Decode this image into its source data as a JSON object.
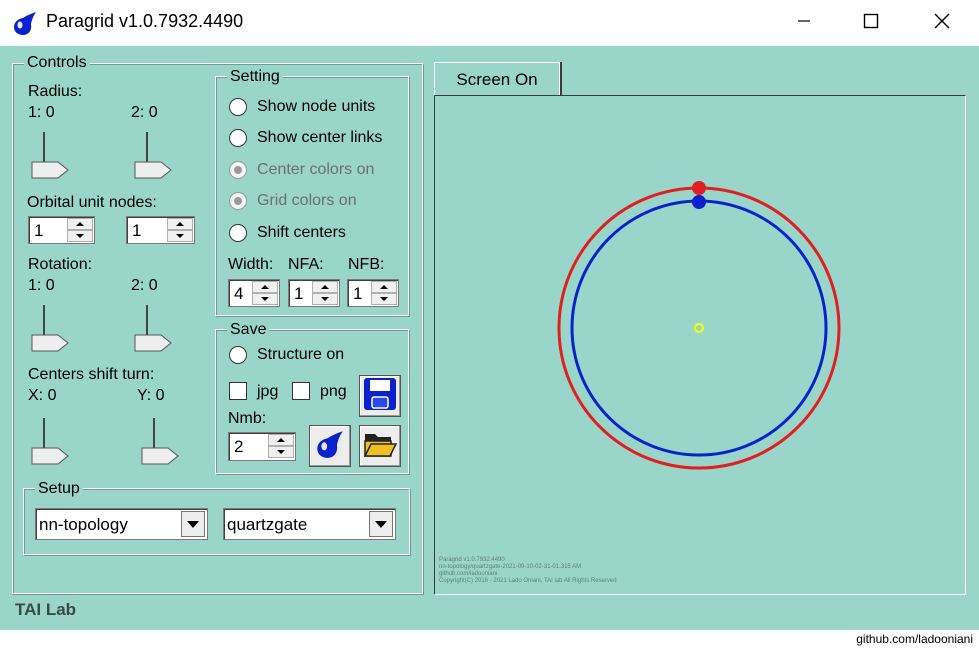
{
  "window": {
    "title": "Paragrid v1.0.7932.4490",
    "icon": "blue-drop-icon",
    "buttons": [
      "minimize-icon",
      "maximize-icon",
      "close-icon"
    ]
  },
  "colors": {
    "client_bg": "#99d6c9",
    "outer_circle": "#e02020",
    "inner_circle": "#0a22cc",
    "center": "#ffff00",
    "accent_blue": "#0a22cc",
    "folder": "#f0c020"
  },
  "controls": {
    "legend": "Controls",
    "radius_label": "Radius:",
    "radius_1": "1: 0",
    "radius_2": "2: 0",
    "radius_values": [
      0,
      0
    ],
    "orbital_label": "Orbital unit nodes:",
    "orbital_1": "1",
    "orbital_2": "1",
    "rotation_label": "Rotation:",
    "rotation_1": "1: 0",
    "rotation_2": "2: 0",
    "rotation_values": [
      0,
      0
    ],
    "shift_label": "Centers shift turn:",
    "shift_x": "X: 0",
    "shift_y": "Y: 0",
    "shift_values": [
      0,
      0
    ]
  },
  "setting": {
    "legend": "Setting",
    "options": [
      {
        "label": "Show node units",
        "checked": false,
        "enabled": true
      },
      {
        "label": "Show center links",
        "checked": false,
        "enabled": true
      },
      {
        "label": "Center colors on",
        "checked": true,
        "enabled": false
      },
      {
        "label": "Grid colors on",
        "checked": true,
        "enabled": false
      },
      {
        "label": "Shift centers",
        "checked": false,
        "enabled": true
      }
    ],
    "width_label": "Width:",
    "width_value": "4",
    "nfa_label": "NFA:",
    "nfa_value": "1",
    "nfb_label": "NFB:",
    "nfb_value": "1"
  },
  "save": {
    "legend": "Save",
    "structure_label": "Structure on",
    "jpg_label": "jpg",
    "png_label": "png",
    "nmb_label": "Nmb:",
    "nmb_value": "2",
    "icons": [
      "floppy-disk-icon",
      "blue-drop-icon",
      "open-folder-icon"
    ]
  },
  "setup": {
    "legend": "Setup",
    "combo_1": "nn-topology",
    "combo_2": "quartzgate"
  },
  "footer": {
    "lab_label": "TAI Lab",
    "github": "github.com/ladooniani"
  },
  "canvas": {
    "tab_label": "Screen On",
    "copyright_lines": [
      "Paragrid v1.0.7932.4490",
      "nn-topology/quartzgate-2021-09-10-02-31-01.315 AM",
      "github.com/ladooniani",
      "Copyright(C) 2016 - 2021 Lado Oniani, TAI lab All Rights Reserved"
    ]
  }
}
